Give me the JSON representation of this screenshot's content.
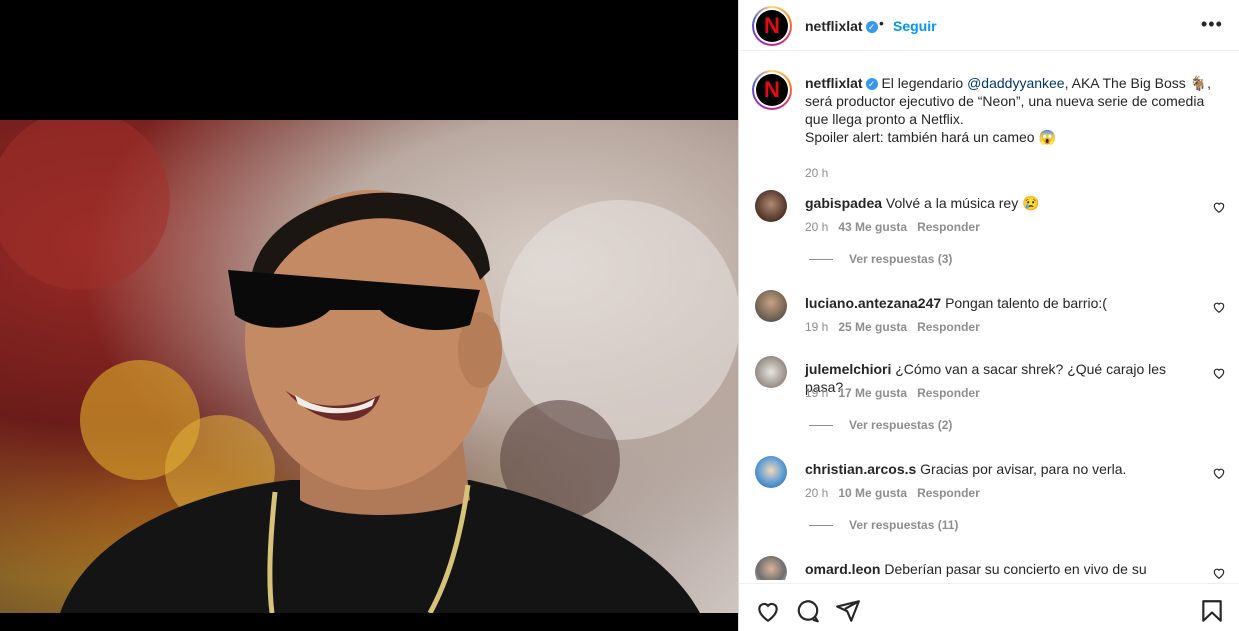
{
  "header": {
    "username": "netflixlat",
    "verified_mark": "✓",
    "separator": "•",
    "follow_label": "Seguir",
    "more_label": "•••"
  },
  "caption": {
    "username": "netflixlat",
    "verified_mark": "✓",
    "intro": "El legendario",
    "mention": "@daddyyankee",
    "text_after": ", AKA The Big Boss 🐐, será productor ejecutivo de “Neon”, una nueva serie de comedia que llega pronto a Netflix.",
    "line2": "Spoiler alert: también hará un cameo 😱",
    "time": "20 h"
  },
  "comments": [
    {
      "username": "gabispadea",
      "text": "Volvé a la música rey 😢",
      "time": "20 h",
      "likes": "43 Me gusta",
      "reply": "Responder",
      "replies": "Ver respuestas (3)"
    },
    {
      "username": "luciano.antezana247",
      "text": "Pongan talento de barrio:(",
      "time": "19 h",
      "likes": "25 Me gusta",
      "reply": "Responder",
      "replies": ""
    },
    {
      "username": "julemelchiori",
      "text": "¿Cómo van a sacar shrek? ¿Qué carajo les pasa?",
      "time": "19 h",
      "likes": "17 Me gusta",
      "reply": "Responder",
      "replies": "Ver respuestas (2)"
    },
    {
      "username": "christian.arcos.s",
      "text": "Gracias por avisar, para no verla.",
      "time": "20 h",
      "likes": "10 Me gusta",
      "reply": "Responder",
      "replies": "Ver respuestas (11)"
    },
    {
      "username": "omard.leon",
      "text": "Deberían pasar su concierto en vivo de su última",
      "time": "",
      "likes": "",
      "reply": "",
      "replies": ""
    }
  ],
  "logo_letter": "N",
  "icons": [
    "heart-icon",
    "comment-icon",
    "share-icon",
    "bookmark-icon"
  ],
  "colors": {
    "link": "#0095f6",
    "mention": "#00376b",
    "muted": "#8e8e8e",
    "netflix_red": "#e50914"
  }
}
